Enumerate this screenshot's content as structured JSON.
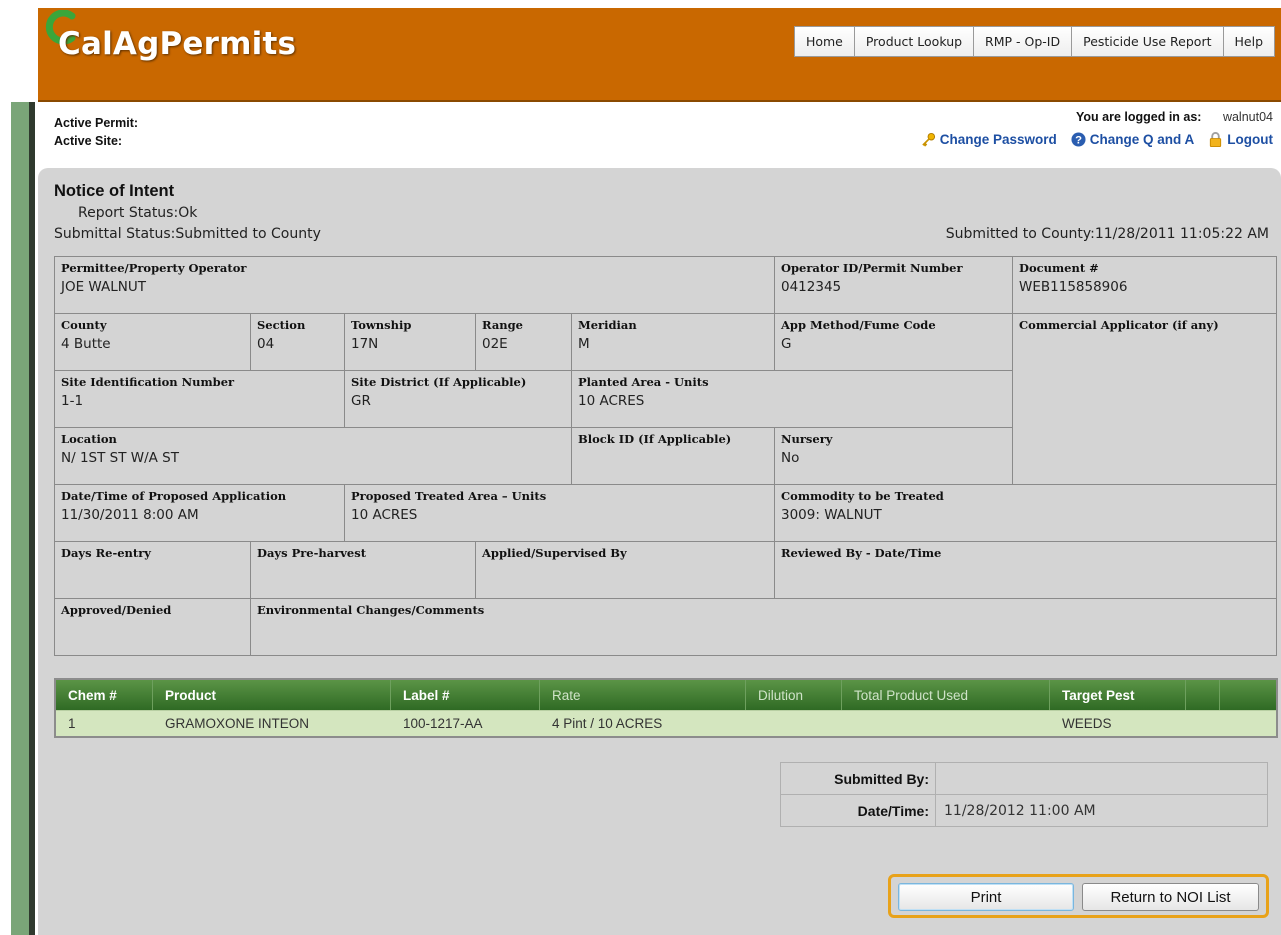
{
  "header": {
    "logo_text": "CalAgPermits",
    "nav": [
      "Home",
      "Product Lookup",
      "RMP - Op-ID",
      "Pesticide Use Report",
      "Help"
    ]
  },
  "status": {
    "active_permit_label": "Active Permit:",
    "active_site_label": "Active Site:",
    "logged_in_label": "You are logged in as:",
    "username": "walnut04",
    "change_password": "Change Password",
    "change_qa": "Change Q and A",
    "logout": "Logout"
  },
  "notice": {
    "title": "Notice of Intent",
    "report_status": "Report Status:Ok",
    "submittal_status": "Submittal Status:Submitted to County",
    "submitted_to_county": "Submitted to County:11/28/2011 11:05:22 AM"
  },
  "fields": {
    "permittee_label": "Permittee/Property Operator",
    "permittee": "JOE WALNUT",
    "operator_id_label": "Operator ID/Permit Number",
    "operator_id": "0412345",
    "document_label": "Document #",
    "document": "WEB115858906",
    "county_label": "County",
    "county": "4  Butte",
    "section_label": "Section",
    "section": "04",
    "township_label": "Township",
    "township": "17N",
    "range_label": "Range",
    "range": "02E",
    "meridian_label": "Meridian",
    "meridian": "M",
    "app_method_label": "App Method/Fume Code",
    "app_method": "G",
    "commercial_applicator_label": "Commercial Applicator (if any)",
    "site_id_label": "Site Identification Number",
    "site_id": "1-1",
    "site_district_label": "Site District (If Applicable)",
    "site_district": "GR",
    "planted_area_label": "Planted Area - Units",
    "planted_area": "10  ACRES",
    "location_label": "Location",
    "location": "N/ 1ST ST W/A ST",
    "block_id_label": "Block ID (If Applicable)",
    "nursery_label": "Nursery",
    "nursery": "No",
    "proposed_app_label": "Date/Time of Proposed Application",
    "proposed_app": "11/30/2011 8:00 AM",
    "treated_area_label": "Proposed Treated Area – Units",
    "treated_area": "10 ACRES",
    "commodity_label": "Commodity to be Treated",
    "commodity": "3009: WALNUT",
    "days_reentry_label": "Days Re-entry",
    "days_preharvest_label": "Days Pre-harvest",
    "applied_by_label": "Applied/Supervised By",
    "reviewed_by_label": "Reviewed By - Date/Time",
    "approved_label": "Approved/Denied",
    "env_changes_label": "Environmental Changes/Comments"
  },
  "chem_grid": {
    "headers": [
      "Chem #",
      "Product",
      "Label #",
      "Rate",
      "Dilution",
      "Total Product Used",
      "Target Pest"
    ],
    "rows": [
      [
        "1",
        "GRAMOXONE INTEON",
        "100-1217-AA",
        "4  Pint /  10 ACRES",
        "",
        "",
        "WEEDS"
      ]
    ]
  },
  "submitted": {
    "by_label": "Submitted By:",
    "by": "",
    "datetime_label": "Date/Time:",
    "datetime": "11/28/2012 11:00 AM"
  },
  "buttons": {
    "print": "Print",
    "return": "Return to NOI List"
  },
  "colors": {
    "header_bg": "#c96800",
    "panel_bg": "#d4d4d4",
    "grid_header": "#3f7a30",
    "grid_row": "#d4e6bf",
    "link": "#1d4fa3",
    "button_highlight": "#e8a21a"
  },
  "icons": {
    "password": "key-icon",
    "qa": "question-icon",
    "logout": "lock-icon"
  }
}
